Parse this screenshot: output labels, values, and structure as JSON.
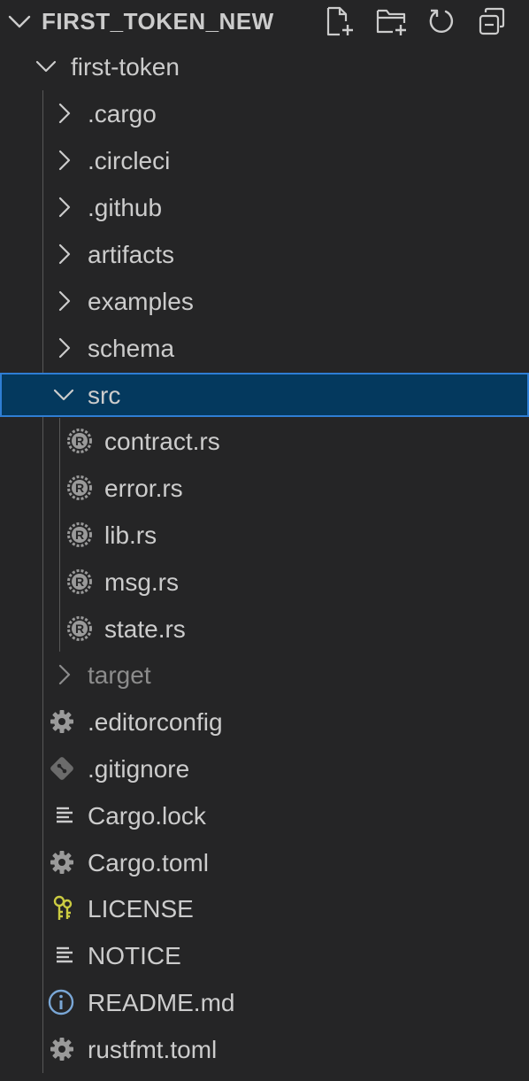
{
  "explorer": {
    "title": "FIRST_TOKEN_NEW",
    "actions": [
      {
        "name": "new-file",
        "icon": "new-file-icon"
      },
      {
        "name": "new-folder",
        "icon": "new-folder-icon"
      },
      {
        "name": "refresh",
        "icon": "refresh-icon"
      },
      {
        "name": "collapse-all",
        "icon": "collapse-all-icon"
      }
    ]
  },
  "tree": {
    "root": "first-token",
    "folders": [
      ".cargo",
      ".circleci",
      ".github",
      "artifacts",
      "examples",
      "schema"
    ],
    "src": {
      "label": "src",
      "files": [
        "contract.rs",
        "error.rs",
        "lib.rs",
        "msg.rs",
        "state.rs"
      ]
    },
    "target": "target",
    "files": [
      {
        "label": ".editorconfig",
        "icon": "gear-icon"
      },
      {
        "label": ".gitignore",
        "icon": "git-icon"
      },
      {
        "label": "Cargo.lock",
        "icon": "lines-icon"
      },
      {
        "label": "Cargo.toml",
        "icon": "gear-icon"
      },
      {
        "label": "LICENSE",
        "icon": "license-key-icon"
      },
      {
        "label": "NOTICE",
        "icon": "lines-icon"
      },
      {
        "label": "README.md",
        "icon": "info-icon"
      },
      {
        "label": "rustfmt.toml",
        "icon": "gear-icon"
      }
    ]
  },
  "colors": {
    "background": "#252526",
    "selection": "#04395e",
    "selection_border": "#2f7ed4",
    "text": "#cccccc",
    "dim_text": "#8c8c8c",
    "license_icon": "#cbcb41"
  }
}
